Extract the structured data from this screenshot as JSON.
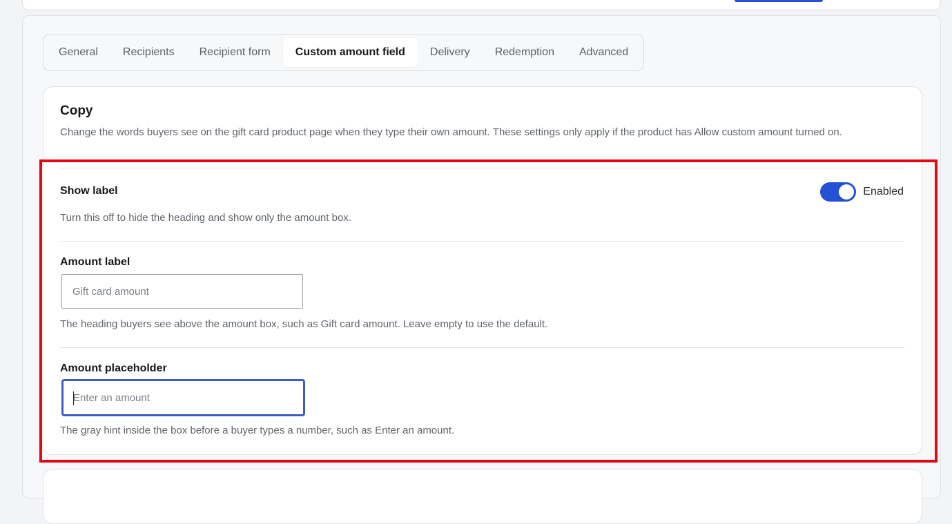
{
  "tabs": [
    {
      "label": "General",
      "active": false
    },
    {
      "label": "Recipients",
      "active": false
    },
    {
      "label": "Recipient form",
      "active": false
    },
    {
      "label": "Custom amount field",
      "active": true
    },
    {
      "label": "Delivery",
      "active": false
    },
    {
      "label": "Redemption",
      "active": false
    },
    {
      "label": "Advanced",
      "active": false
    }
  ],
  "copy": {
    "title": "Copy",
    "description": "Change the words buyers see on the gift card product page when they type their own amount. These settings only apply if the product has Allow custom amount turned on."
  },
  "show_label": {
    "title": "Show label",
    "help": "Turn this off to hide the heading and show only the amount box.",
    "toggle_state": "Enabled",
    "enabled": true
  },
  "amount_label": {
    "title": "Amount label",
    "placeholder": "Gift card amount",
    "value": "",
    "help": "The heading buyers see above the amount box, such as Gift card amount. Leave empty to use the default."
  },
  "amount_placeholder": {
    "title": "Amount placeholder",
    "placeholder": "Enter an amount",
    "value": "",
    "focused": true,
    "help": "The gray hint inside the box before a buyer types a number, such as Enter an amount."
  },
  "colors": {
    "accent": "#2450d6",
    "focus_ring": "#3d5cc4",
    "highlight": "#e30613"
  }
}
